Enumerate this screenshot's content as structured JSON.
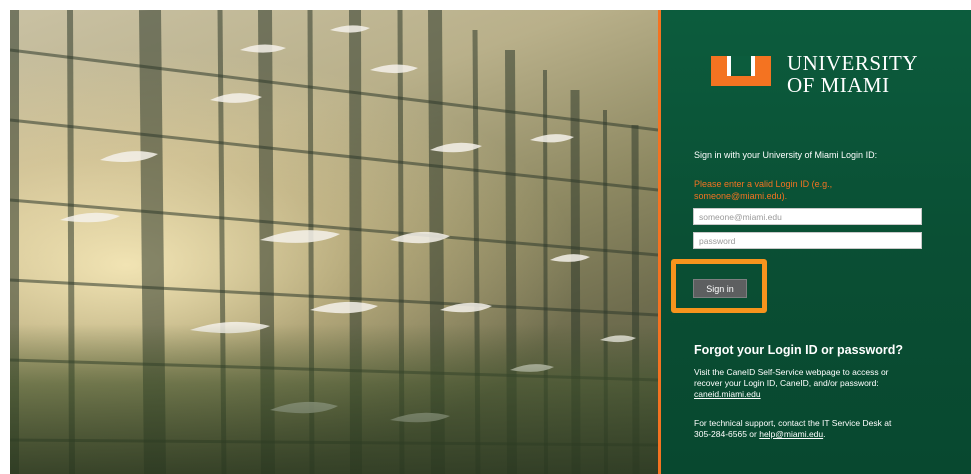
{
  "colors": {
    "brand_green": "#0c5c3d",
    "brand_orange": "#f47321",
    "highlight": "#f7941d"
  },
  "photo": {
    "description_icon": "atrium-birds-photo"
  },
  "logo": {
    "line1": "UNIVERSITY",
    "line2": "OF MIAMI",
    "icon": "u-logo-icon"
  },
  "login": {
    "intro": "Sign in with your University of Miami Login ID:",
    "error_line1": "Please enter a valid Login ID (e.g.,",
    "error_line2": "someone@miami.edu).",
    "username_placeholder": "someone@miami.edu",
    "username_value": "",
    "password_placeholder": "password",
    "password_value": "",
    "signin_label": "Sign in"
  },
  "help": {
    "title": "Forgot your Login ID or password?",
    "selfservice_line1": "Visit the CaneID Self-Service webpage to access or",
    "selfservice_line2": "recover your Login ID, CaneID, and/or password:",
    "selfservice_link": "caneid.miami.edu",
    "support_line1": "For technical support, contact the IT Service Desk at",
    "support_prefix": "305-284-6565 or ",
    "support_email": "help@miami.edu",
    "support_suffix": "."
  }
}
